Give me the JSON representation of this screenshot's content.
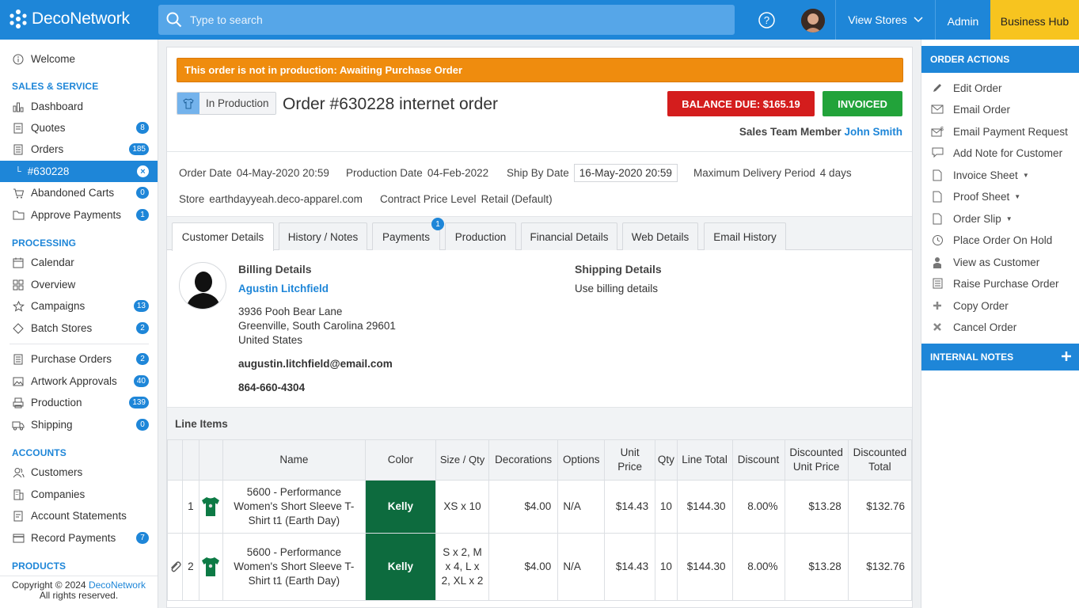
{
  "topbar": {
    "logo_text": "DecoNetwork",
    "search_placeholder": "Type to search",
    "view_stores": "View Stores",
    "admin": "Admin",
    "business_hub": "Business Hub"
  },
  "sidebar": {
    "welcome": "Welcome",
    "sections": {
      "sales": "SALES & SERVICE",
      "processing": "PROCESSING",
      "accounts": "ACCOUNTS",
      "products": "PRODUCTS"
    },
    "items": {
      "dashboard": {
        "label": "Dashboard"
      },
      "quotes": {
        "label": "Quotes",
        "badge": "8"
      },
      "orders": {
        "label": "Orders",
        "badge": "185"
      },
      "current_order": {
        "label": "#630228",
        "badge": "×"
      },
      "abandoned_carts": {
        "label": "Abandoned Carts",
        "badge": "0"
      },
      "approve_payments": {
        "label": "Approve Payments",
        "badge": "1"
      },
      "calendar": {
        "label": "Calendar"
      },
      "overview": {
        "label": "Overview"
      },
      "campaigns": {
        "label": "Campaigns",
        "badge": "13"
      },
      "batch_stores": {
        "label": "Batch Stores",
        "badge": "2"
      },
      "purchase_orders": {
        "label": "Purchase Orders",
        "badge": "2"
      },
      "artwork_approvals": {
        "label": "Artwork Approvals",
        "badge": "40"
      },
      "production": {
        "label": "Production",
        "badge": "139"
      },
      "shipping": {
        "label": "Shipping",
        "badge": "0"
      },
      "customers": {
        "label": "Customers"
      },
      "companies": {
        "label": "Companies"
      },
      "account_statements": {
        "label": "Account Statements"
      },
      "record_payments": {
        "label": "Record Payments",
        "badge": "7"
      }
    },
    "copyright_prefix": "Copyright © 2024",
    "copyright_link": "DecoNetwork",
    "copyright_suffix": "All rights reserved."
  },
  "order": {
    "alert": "This order is not in production: Awaiting Purchase Order",
    "status_tag": "In Production",
    "title": "Order #630228 internet order",
    "balance_due": "BALANCE DUE: $165.19",
    "invoiced": "INVOICED",
    "sales_label": "Sales Team Member",
    "sales_name": "John Smith",
    "order_date_label": "Order Date",
    "order_date": "04-May-2020 20:59",
    "production_date_label": "Production Date",
    "production_date": "04-Feb-2022",
    "ship_by_label": "Ship By Date",
    "ship_by": "16-May-2020 20:59",
    "max_delivery_label": "Maximum Delivery Period",
    "max_delivery": "4 days",
    "store_label": "Store",
    "store": "earthdayyeah.deco-apparel.com",
    "price_level_label": "Contract Price Level",
    "price_level": "Retail (Default)"
  },
  "tabs": [
    {
      "label": "Customer Details"
    },
    {
      "label": "History / Notes"
    },
    {
      "label": "Payments",
      "badge": "1"
    },
    {
      "label": "Production"
    },
    {
      "label": "Financial Details"
    },
    {
      "label": "Web Details"
    },
    {
      "label": "Email History"
    }
  ],
  "customer": {
    "billing_title": "Billing Details",
    "name": "Agustin Litchfield",
    "address1": "3936 Pooh Bear Lane",
    "address2": "Greenville, South Carolina 29601",
    "country": "United States",
    "email": "augustin.litchfield@email.com",
    "phone": "864-660-4304",
    "shipping_title": "Shipping Details",
    "shipping_text": "Use billing details"
  },
  "line_items": {
    "title": "Line Items",
    "headers": [
      "Name",
      "Color",
      "Size / Qty",
      "Decorations",
      "Options",
      "Unit Price",
      "Qty",
      "Line Total",
      "Discount",
      "Discounted Unit Price",
      "Discounted Total"
    ],
    "rows": [
      {
        "index": "1",
        "name": "5600 - Performance Women's Short Sleeve T-Shirt t1 (Earth Day)",
        "color": "Kelly",
        "size_qty": "XS x 10",
        "decorations": "$4.00",
        "options": "N/A",
        "unit_price": "$14.43",
        "qty": "10",
        "line_total": "$144.30",
        "discount": "8.00%",
        "disc_unit": "$13.28",
        "disc_total": "$132.76"
      },
      {
        "index": "2",
        "name": "5600 - Performance Women's Short Sleeve T-Shirt t1 (Earth Day)",
        "color": "Kelly",
        "size_qty": "S x 2, M x 4, L x 2, XL x 2",
        "decorations": "$4.00",
        "options": "N/A",
        "unit_price": "$14.43",
        "qty": "10",
        "line_total": "$144.30",
        "discount": "8.00%",
        "disc_unit": "$13.28",
        "disc_total": "$132.76"
      }
    ]
  },
  "right_panel": {
    "order_actions_title": "ORDER ACTIONS",
    "actions": {
      "edit": "Edit Order",
      "email": "Email Order",
      "email_payment": "Email Payment Request",
      "add_note": "Add Note for Customer",
      "invoice_sheet": "Invoice Sheet",
      "proof_sheet": "Proof Sheet",
      "order_slip": "Order Slip",
      "hold": "Place Order On Hold",
      "view_customer": "View as Customer",
      "raise_po": "Raise Purchase Order",
      "copy": "Copy Order",
      "cancel": "Cancel Order"
    },
    "internal_notes_title": "INTERNAL NOTES"
  },
  "colors": {
    "brand_blue": "#1e86d8",
    "alert_orange": "#ef8c0e",
    "balance_red": "#d41d1d",
    "invoiced_green": "#22a33a",
    "kelly_green": "#0d6b3e",
    "business_hub_yellow": "#f7c41f"
  }
}
